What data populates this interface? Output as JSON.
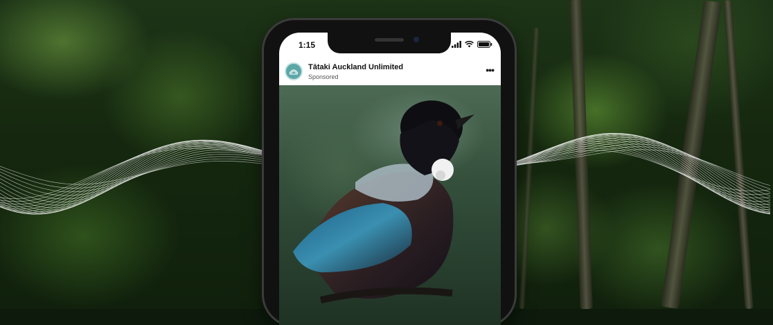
{
  "status_bar": {
    "time": "1:15"
  },
  "post": {
    "account_name": "Tātaki Auckland Unlimited",
    "sponsored_label": "Sponsored",
    "more_icon": "more-horizontal-icon"
  },
  "colors": {
    "forest_dark": "#10200c",
    "avatar_teal": "#5da7a7",
    "wave_white": "#ffffff"
  }
}
